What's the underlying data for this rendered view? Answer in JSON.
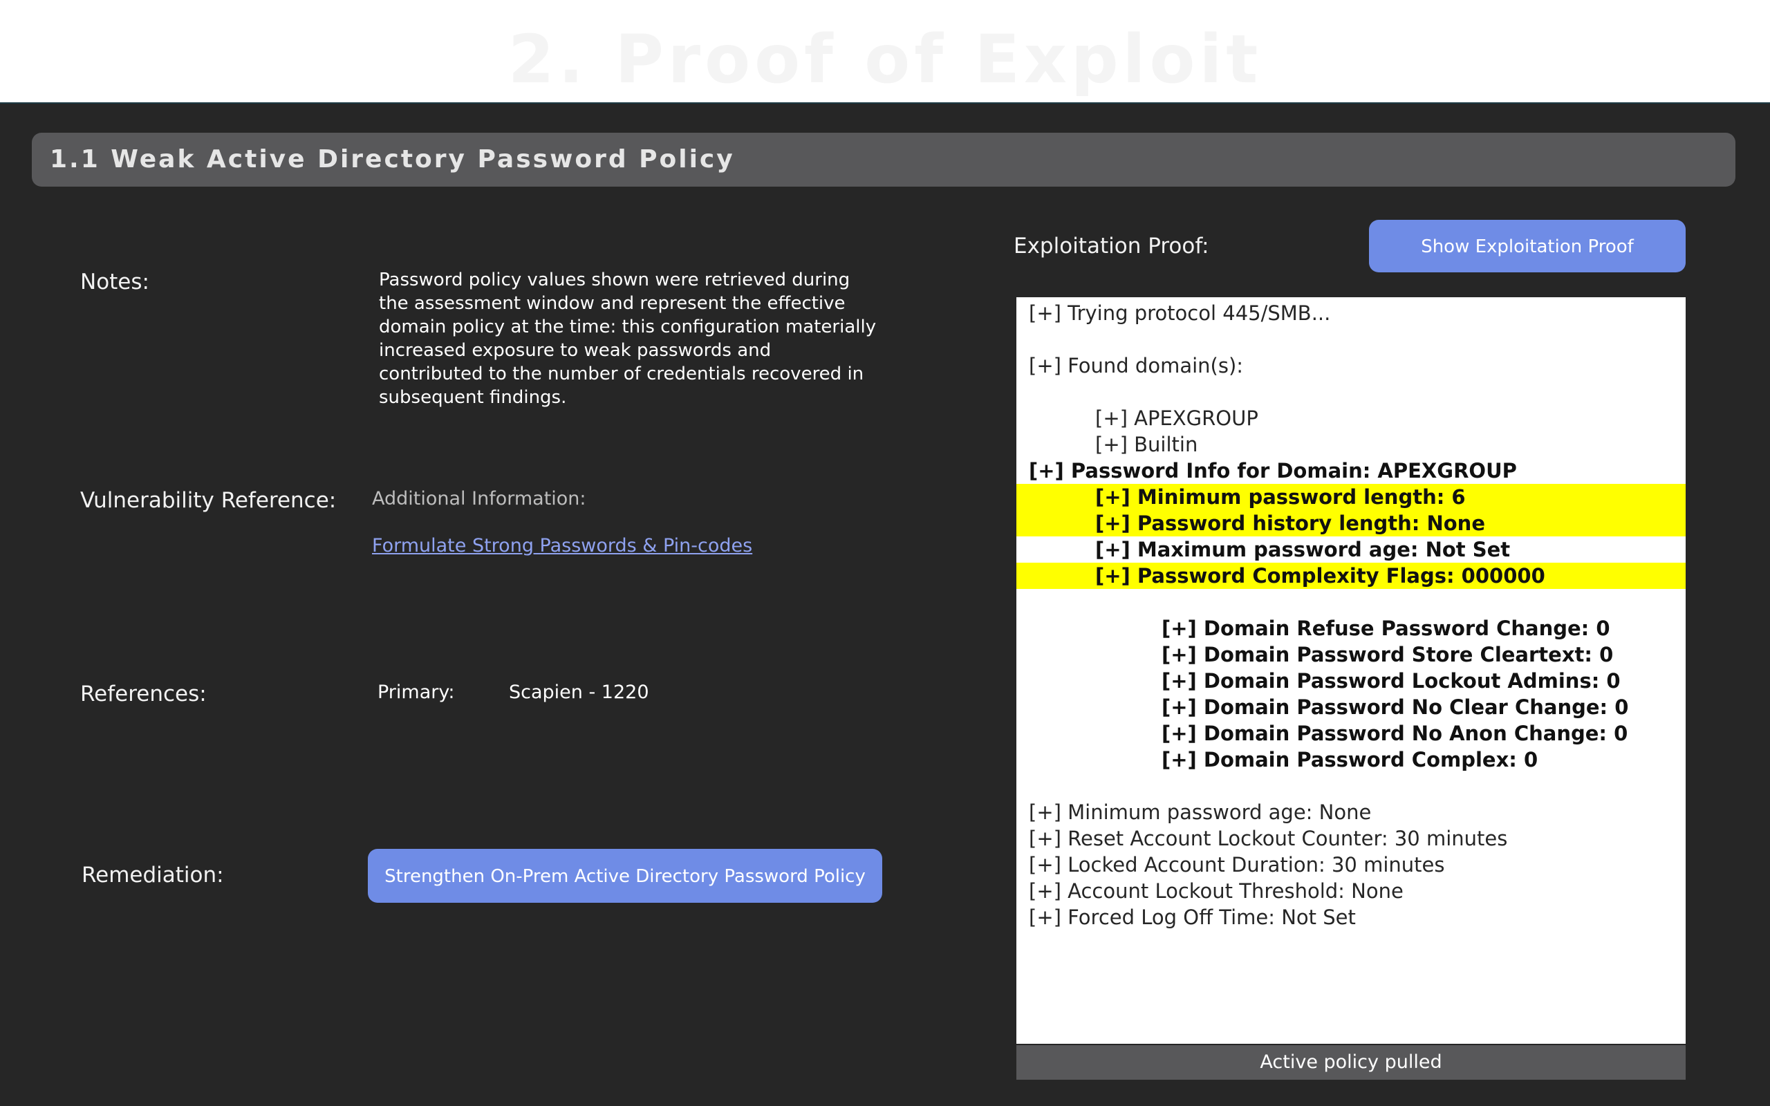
{
  "page": {
    "title": "2. Proof of Exploit"
  },
  "section": {
    "title": "1.1 Weak Active Directory Password Policy"
  },
  "notes": {
    "label": "Notes:",
    "text": "Password policy values shown were retrieved during the assessment window and represent the effective domain policy at the time: this configuration materially increased exposure to weak passwords and contributed to the number of credentials recovered in subsequent findings."
  },
  "vulnerability_reference": {
    "label": "Vulnerability Reference:",
    "additional_info": "Additional Information:",
    "link_text": "Formulate Strong Passwords & Pin-codes"
  },
  "references": {
    "label": "References:",
    "primary_label": "Primary:",
    "primary_value": "Scapien - 1220"
  },
  "remediation": {
    "label": "Remediation:",
    "button_label": "Strengthen On-Prem Active Directory Password Policy"
  },
  "exploitation_proof": {
    "label": "Exploitation Proof:",
    "button_label": "Show Exploitation Proof",
    "highlight_color": "#ffff00",
    "lines": [
      {
        "text": "[+] Trying protocol 445/SMB...",
        "indent": 0,
        "bold": false,
        "highlight": false
      },
      {
        "text": "[+] Found domain(s):",
        "indent": 0,
        "bold": false,
        "highlight": false
      },
      {
        "text": "[+] APEXGROUP",
        "indent": 1,
        "bold": false,
        "highlight": false
      },
      {
        "text": "[+] Builtin",
        "indent": 1,
        "bold": false,
        "highlight": false
      },
      {
        "text": "[+] Password Info for Domain: APEXGROUP",
        "indent": 0,
        "bold": true,
        "highlight": false
      },
      {
        "text": "[+] Minimum password length: 6",
        "indent": 1,
        "bold": true,
        "highlight": true
      },
      {
        "text": "[+] Password history length: None",
        "indent": 1,
        "bold": true,
        "highlight": true
      },
      {
        "text": "[+] Maximum password age: Not Set",
        "indent": 1,
        "bold": true,
        "highlight": false
      },
      {
        "text": "[+] Password Complexity Flags: 000000",
        "indent": 1,
        "bold": true,
        "highlight": true
      },
      {
        "text": "[+] Domain Refuse Password Change: 0",
        "indent": 2,
        "bold": true,
        "highlight": false
      },
      {
        "text": "[+] Domain Password Store Cleartext: 0",
        "indent": 2,
        "bold": true,
        "highlight": false
      },
      {
        "text": "[+] Domain Password Lockout Admins: 0",
        "indent": 2,
        "bold": true,
        "highlight": false
      },
      {
        "text": "[+] Domain Password No Clear Change: 0",
        "indent": 2,
        "bold": true,
        "highlight": false
      },
      {
        "text": "[+] Domain Password No Anon Change: 0",
        "indent": 2,
        "bold": true,
        "highlight": false
      },
      {
        "text": "[+] Domain Password Complex: 0",
        "indent": 2,
        "bold": true,
        "highlight": false
      },
      {
        "text": "[+] Minimum password age: None",
        "indent": 0,
        "bold": false,
        "highlight": false
      },
      {
        "text": "[+] Reset Account Lockout Counter: 30 minutes",
        "indent": 0,
        "bold": false,
        "highlight": false
      },
      {
        "text": "[+] Locked Account Duration: 30 minutes",
        "indent": 0,
        "bold": false,
        "highlight": false
      },
      {
        "text": "[+] Account Lockout Threshold: None",
        "indent": 0,
        "bold": false,
        "highlight": false
      },
      {
        "text": "[+] Forced Log Off Time: Not Set",
        "indent": 0,
        "bold": false,
        "highlight": false
      }
    ],
    "footer_text": "Active policy pulled"
  }
}
